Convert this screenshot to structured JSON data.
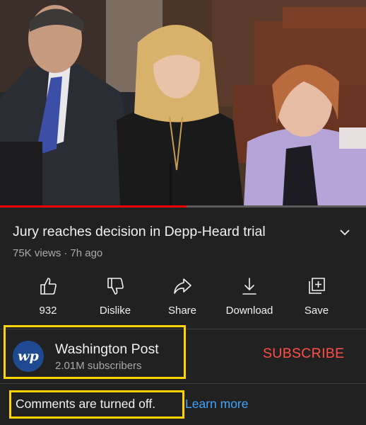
{
  "video": {
    "progress_fraction": 0.51
  },
  "title": "Jury reaches decision in Depp-Heard trial",
  "meta": {
    "views": "75K views",
    "separator": "·",
    "age": "7h ago"
  },
  "actions": [
    {
      "icon": "thumbs-up-icon",
      "label": "932"
    },
    {
      "icon": "thumbs-down-icon",
      "label": "Dislike"
    },
    {
      "icon": "share-icon",
      "label": "Share"
    },
    {
      "icon": "download-icon",
      "label": "Download"
    },
    {
      "icon": "save-to-playlist-icon",
      "label": "Save"
    }
  ],
  "channel": {
    "avatar_text": "wp",
    "avatar_color": "#1f4a91",
    "name": "Washington Post",
    "subscribers": "2.01M subscribers",
    "subscribe_label": "SUBSCRIBE",
    "subscribe_color": "#ff4e45"
  },
  "comments": {
    "status": "Comments are turned off.",
    "learn_more": "Learn more"
  },
  "colors": {
    "background": "#212121",
    "highlight_box": "#ffd400",
    "link": "#3ea6ff",
    "progress": "#ff0000"
  }
}
